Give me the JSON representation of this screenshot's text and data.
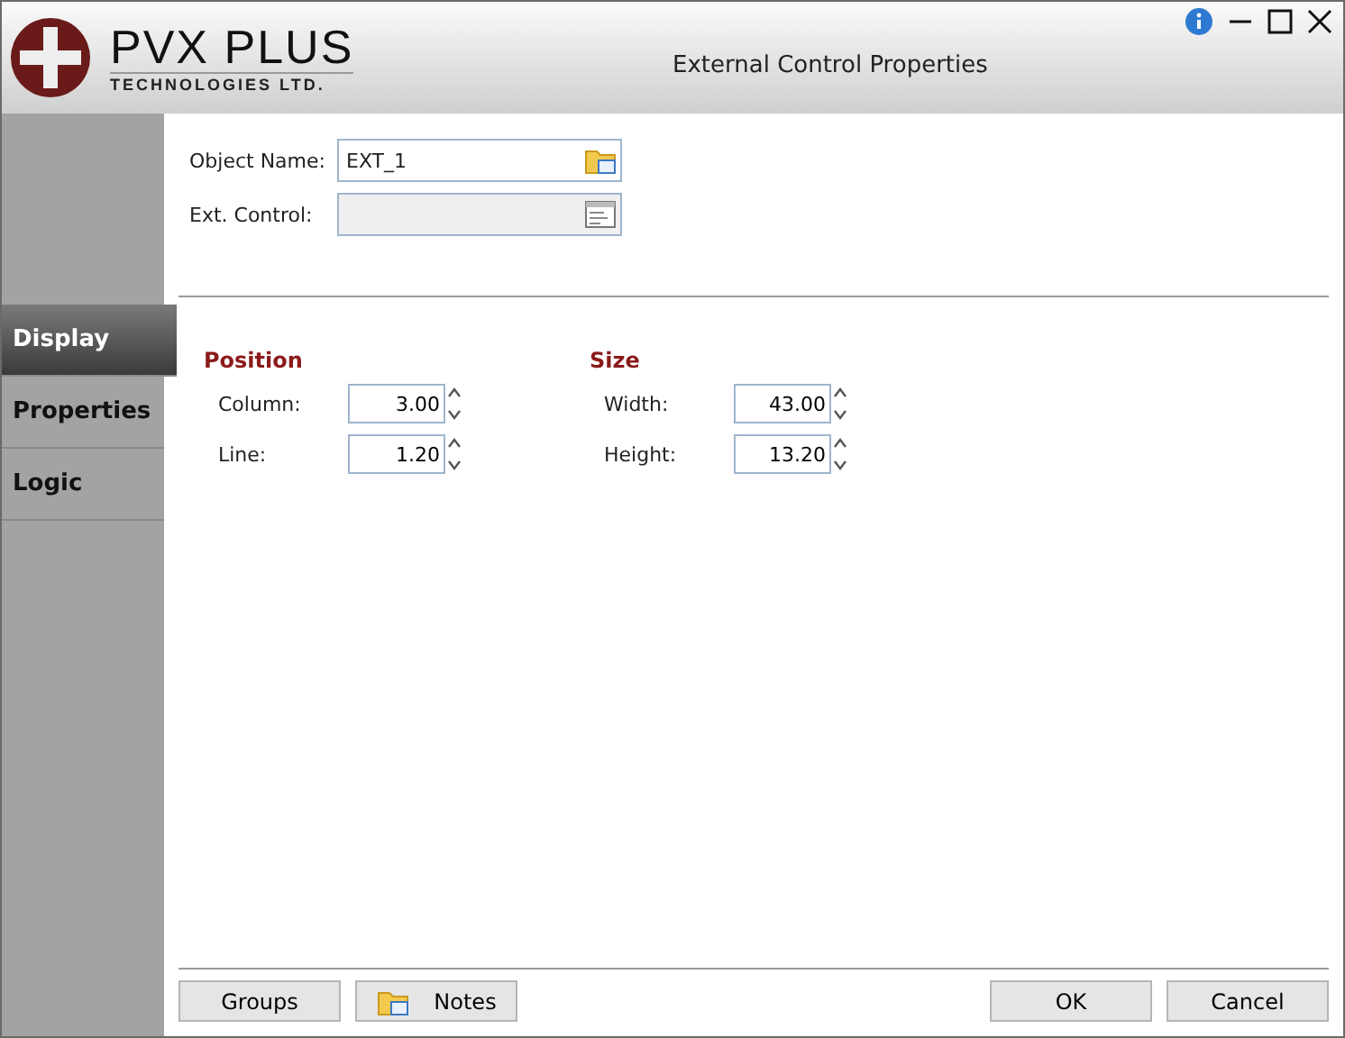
{
  "window": {
    "title": "External Control Properties",
    "logo": {
      "name": "PVX PLUS",
      "tagline": "TECHNOLOGIES LTD."
    }
  },
  "header_fields": [
    {
      "label": "Object Name:",
      "value": "EXT_1",
      "disabled": false
    },
    {
      "label": "Ext. Control:",
      "disabled": true
    }
  ],
  "tabs": [
    {
      "label": "Display",
      "selected": true
    },
    {
      "label": "Properties",
      "selected": false
    },
    {
      "label": "Logic",
      "selected": false
    }
  ],
  "groups": [
    {
      "title": "Position",
      "fields": [
        {
          "label": "Column:",
          "value": "3.00"
        },
        {
          "label": "Line:",
          "value": "1.20"
        }
      ]
    },
    {
      "title": "Size",
      "fields": [
        {
          "label": "Width:",
          "value": "43.00"
        },
        {
          "label": "Height:",
          "value": "13.20"
        }
      ]
    }
  ],
  "footer_left": [
    {
      "label": "Groups",
      "icon": false
    },
    {
      "label": "Notes",
      "icon": true
    }
  ],
  "footer_right": [
    {
      "label": "OK"
    },
    {
      "label": "Cancel"
    }
  ]
}
